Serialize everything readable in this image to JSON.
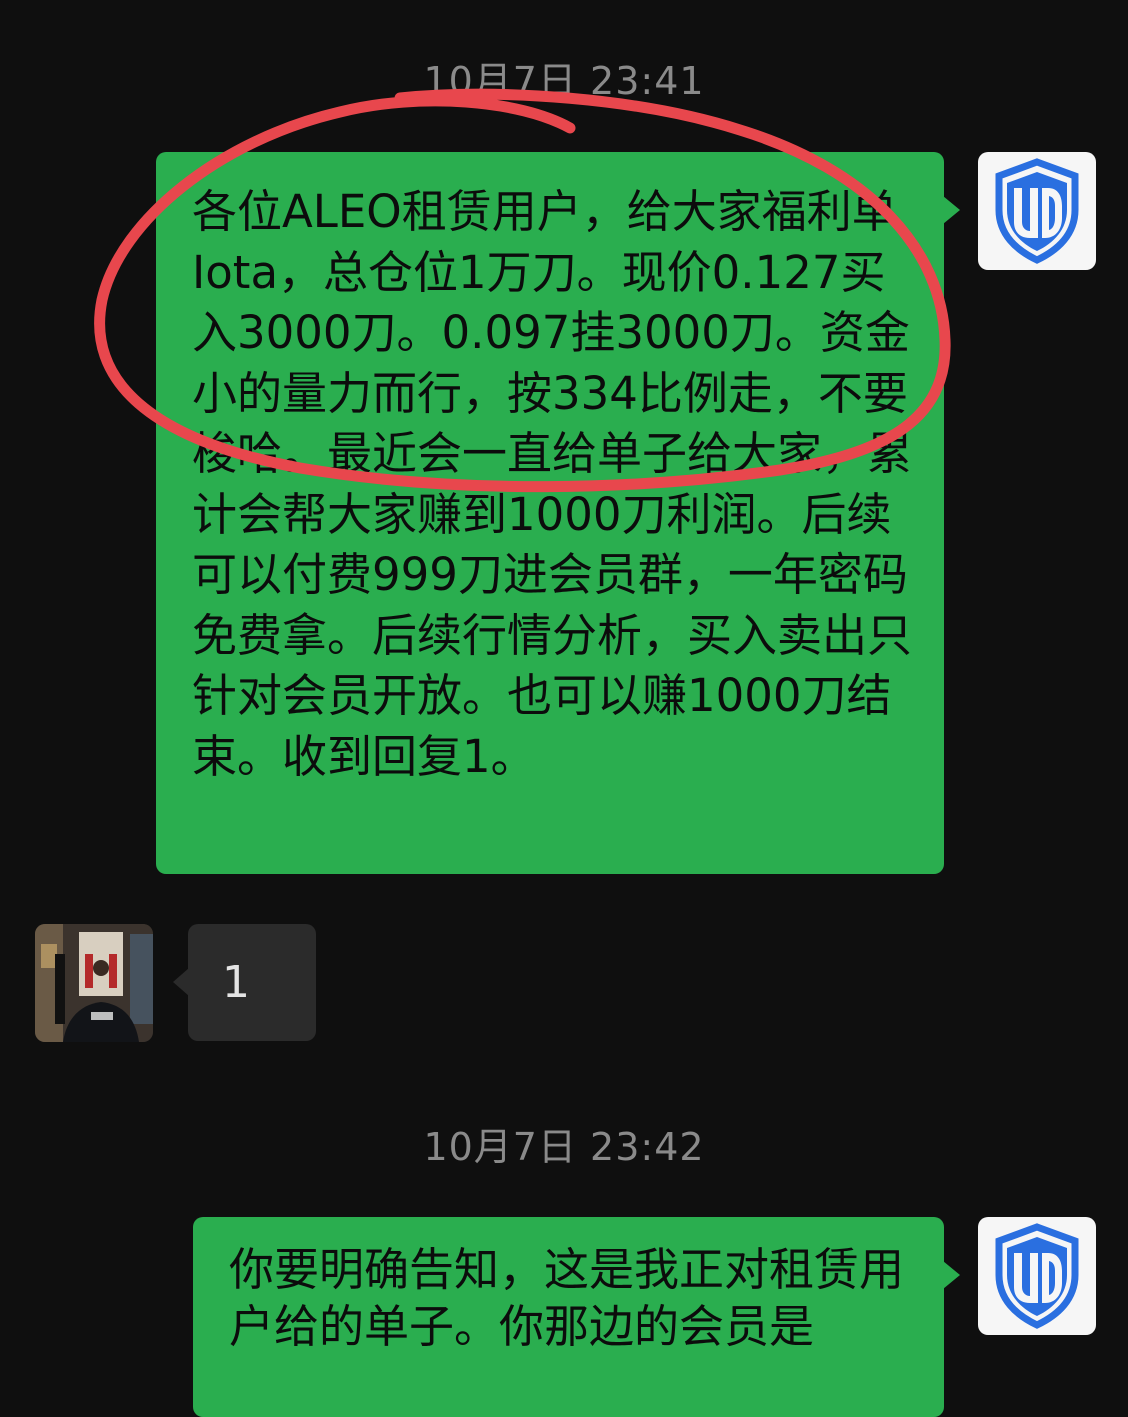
{
  "chat": {
    "timestamps": [
      "10月7日 23:41",
      "10月7日 23:42"
    ],
    "messages": [
      {
        "sender": "self",
        "avatar": "shield-logo",
        "text": "各位ALEO租赁用户，给大家福利单Iota，总仓位1万刀。现价0.127买入3000刀。0.097挂3000刀。资金小的量力而行，按334比例走，不要梭哈。最近会一直给单子给大家，累计会帮大家赚到1000刀利润。后续可以付费999刀进会员群，一年密码免费拿。后续行情分析，买入卖出只针对会员开放。也可以赚1000刀结束。收到回复1。"
      },
      {
        "sender": "other",
        "avatar": "user-photo",
        "text": "1"
      },
      {
        "sender": "self",
        "avatar": "shield-logo",
        "text": "你要明确告知，这是我正对租赁用户给的单子。你那边的会员是"
      }
    ]
  },
  "colors": {
    "background": "#0f0f0f",
    "sent_bubble": "#2aae4f",
    "received_bubble": "#2b2b2b",
    "timestamp_text": "#8a8a8a",
    "annotation_circle": "#e8474d",
    "shield_blue": "#2a6fe0"
  },
  "icons": {
    "self_avatar": "shield-logo-icon",
    "other_avatar": "user-photo-avatar"
  }
}
